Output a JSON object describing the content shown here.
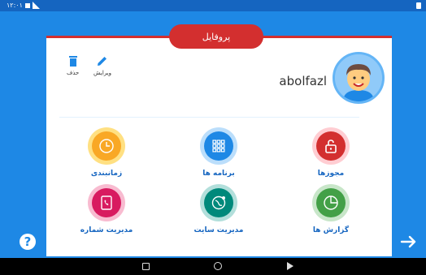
{
  "status_bar": {
    "time": "۱۲:۰۱"
  },
  "profile": {
    "tab_label": "پروفایل",
    "username": "abolfazl"
  },
  "actions": {
    "edit_label": "ویرایش",
    "delete_label": "حذف"
  },
  "grid": [
    {
      "label": "مجوزها",
      "icon": "lock-icon",
      "color": "#d32f2f"
    },
    {
      "label": "برنامه ها",
      "icon": "apps-grid-icon",
      "color": "#1e88e5"
    },
    {
      "label": "زمانبندی",
      "icon": "clock-icon",
      "color": "#f9a825"
    },
    {
      "label": "گزارش ها",
      "icon": "pie-chart-icon",
      "color": "#43a047"
    },
    {
      "label": "مدیریت سایت",
      "icon": "globe-icon",
      "color": "#00897b"
    },
    {
      "label": "مدیریت شماره",
      "icon": "phonebook-icon",
      "color": "#d81b60"
    }
  ],
  "colors": {
    "primary": "#1e88e5",
    "accent": "#d32f2f",
    "label": "#1565c0"
  }
}
